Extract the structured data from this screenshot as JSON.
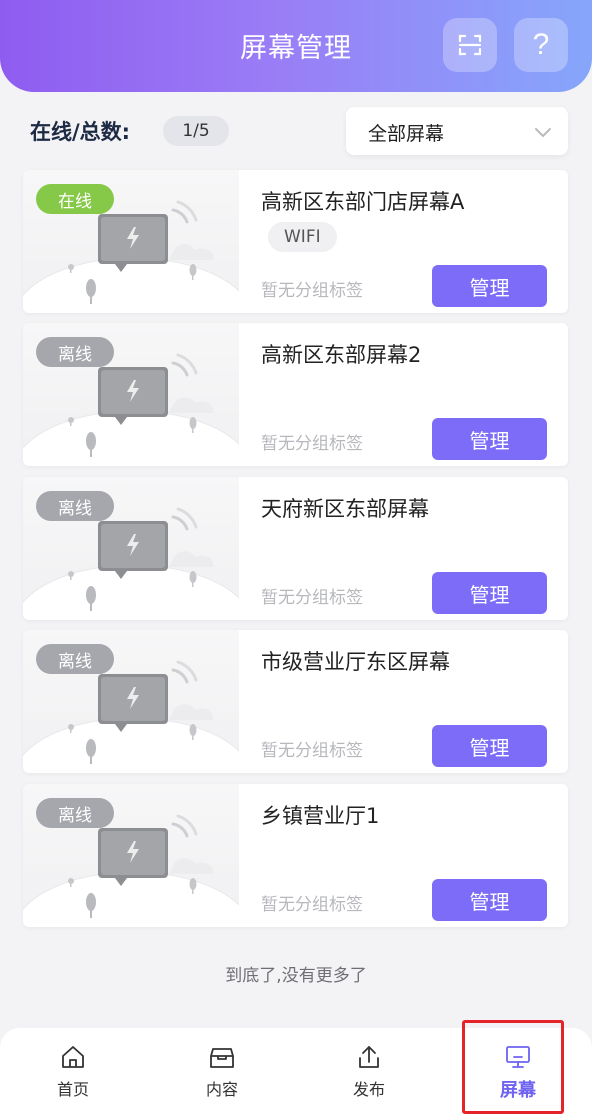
{
  "header": {
    "title": "屏幕管理",
    "help_label": "?"
  },
  "filter": {
    "count_label": "在线/总数:",
    "count_value": "1/5",
    "select_value": "全部屏幕"
  },
  "cards": [
    {
      "status": "在线",
      "status_type": "online",
      "name": "高新区东部门店屏幕A",
      "network": "WIFI",
      "group": "暂无分组标签",
      "manage": "管理"
    },
    {
      "status": "离线",
      "status_type": "offline",
      "name": "高新区东部屏幕2",
      "network": "",
      "group": "暂无分组标签",
      "manage": "管理"
    },
    {
      "status": "离线",
      "status_type": "offline",
      "name": "天府新区东部屏幕",
      "network": "",
      "group": "暂无分组标签",
      "manage": "管理"
    },
    {
      "status": "离线",
      "status_type": "offline",
      "name": "市级营业厅东区屏幕",
      "network": "",
      "group": "暂无分组标签",
      "manage": "管理"
    },
    {
      "status": "离线",
      "status_type": "offline",
      "name": "乡镇营业厅1",
      "network": "",
      "group": "暂无分组标签",
      "manage": "管理"
    }
  ],
  "end_text": "到底了,没有更多了",
  "tabs": [
    {
      "label": "首页",
      "icon": "home-icon",
      "active": false
    },
    {
      "label": "内容",
      "icon": "content-box-icon",
      "active": false
    },
    {
      "label": "发布",
      "icon": "upload-icon",
      "active": false
    },
    {
      "label": "屏幕",
      "icon": "monitor-icon",
      "active": true
    }
  ],
  "colors": {
    "accent": "#7c6cf7",
    "online": "#86c948",
    "offline": "#a6a7ad",
    "highlight": "#e5242a"
  }
}
